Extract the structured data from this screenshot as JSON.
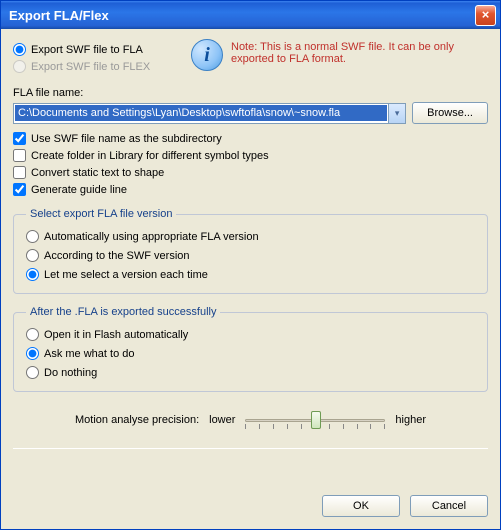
{
  "window": {
    "title": "Export FLA/Flex"
  },
  "export_mode": {
    "to_fla": "Export SWF file to FLA",
    "to_flex": "Export SWF file to FLEX"
  },
  "note": "Note: This is a normal SWF file. It can be only exported to FLA format.",
  "file": {
    "label": "FLA file name:",
    "path": "C:\\Documents and Settings\\Lyan\\Desktop\\swftofla\\snow\\~snow.fla",
    "browse": "Browse..."
  },
  "options": {
    "use_subdir": "Use SWF file name as the subdirectory",
    "create_folder": "Create folder in Library for different symbol types",
    "convert_text": "Convert static text to shape",
    "guide_line": "Generate guide line"
  },
  "version_group": {
    "legend": "Select export FLA file version",
    "auto": "Automatically using appropriate FLA version",
    "swf": "According to the SWF version",
    "ask": "Let me select a version each time"
  },
  "after_group": {
    "legend": "After the .FLA is exported successfully",
    "open": "Open it in Flash automatically",
    "ask": "Ask me what to do",
    "nothing": "Do nothing"
  },
  "slider": {
    "label": "Motion analyse precision:",
    "low": "lower",
    "high": "higher"
  },
  "buttons": {
    "ok": "OK",
    "cancel": "Cancel"
  }
}
